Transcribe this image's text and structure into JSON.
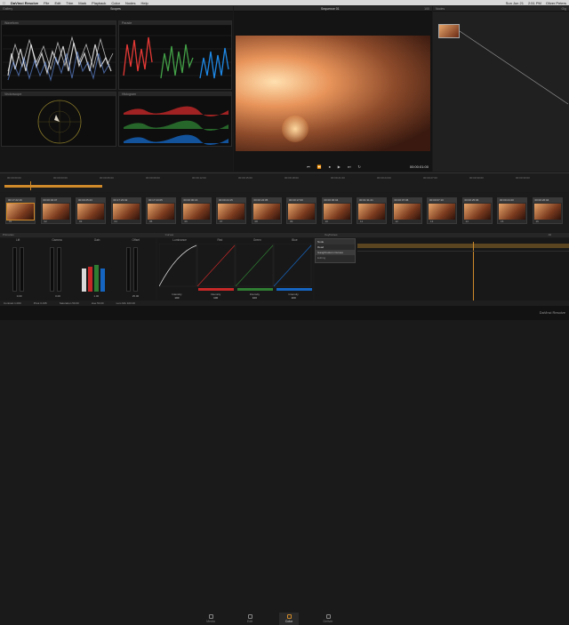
{
  "menubar": {
    "app": "DaVinci Resolve",
    "items": [
      "File",
      "Edit",
      "Trim",
      "Mark",
      "Playback",
      "Color",
      "Nodes",
      "Help"
    ],
    "right": [
      "Sun Jun 21",
      "2:51 PM",
      "Oliver Peters"
    ]
  },
  "panels": {
    "gallery": "Gallery",
    "scopes": "Scopes",
    "waveform": "Waveform",
    "parade": "Parade",
    "vectorscope": "Vectorscope",
    "histogram": "Histogram",
    "viewer_title": "Sequence 01",
    "nodes": "Nodes",
    "lightbox": "Gig"
  },
  "viewer": {
    "timecode": "00:00:01:00",
    "zoom": "100"
  },
  "timeline": {
    "ticks": [
      "00:00:00:00",
      "00:00:03:00",
      "00:00:06:00",
      "00:00:09:00",
      "00:00:12:00",
      "00:00:15:00",
      "00:00:18:00",
      "00:00:21:00",
      "00:00:24:00",
      "00:00:27:00",
      "00:00:30:00",
      "00:00:33:00"
    ]
  },
  "clips": [
    {
      "tc": "00:17:22:16",
      "no": "01"
    },
    {
      "tc": "00:00:02:07",
      "no": "02"
    },
    {
      "tc": "00:00:25:23",
      "no": "03"
    },
    {
      "tc": "00:17:23:02",
      "no": "04"
    },
    {
      "tc": "00:17:23:05",
      "no": "05"
    },
    {
      "tc": "00:00:00:16",
      "no": "06"
    },
    {
      "tc": "00:00:24:15",
      "no": "07"
    },
    {
      "tc": "00:00:22:05",
      "no": "08"
    },
    {
      "tc": "00:00:17:00",
      "no": "09"
    },
    {
      "tc": "00:00:06:04",
      "no": "10"
    },
    {
      "tc": "00:01:31:21",
      "no": "11"
    },
    {
      "tc": "00:00:07:06",
      "no": "12"
    },
    {
      "tc": "00:00:07:10",
      "no": "13"
    },
    {
      "tc": "00:00:25:06",
      "no": "14"
    },
    {
      "tc": "00:00:24:20",
      "no": "15"
    },
    {
      "tc": "00:00:26:04",
      "no": "16"
    }
  ],
  "primaries": {
    "title": "Primaries",
    "wheels": [
      "Lift",
      "Gamma",
      "Gain",
      "Offset"
    ],
    "values": [
      "0.00",
      "0.00",
      "1.00",
      "25.00"
    ]
  },
  "curves": {
    "title": "Curves",
    "labels": [
      "Luminance",
      "Red",
      "Green",
      "Blue"
    ],
    "intensity": "Intensity",
    "intensity_val": "100"
  },
  "keyframes": {
    "title": "Keyframes",
    "all": "All",
    "items": [
      "Sizing",
      "Corrector 1"
    ]
  },
  "popup": {
    "header": "Node",
    "items": [
      "Read",
      "Gang/Custom Curves",
      "Editing"
    ]
  },
  "statusbar": {
    "contrast": "Contrast 1.000",
    "pivot": "Pivot 0.435",
    "saturation": "Saturation 50.00",
    "hue": "Hue 50.00",
    "lum_mix": "Lum Mix 100.00"
  },
  "tabs": [
    "Media",
    "Edit",
    "Color",
    "Deliver"
  ],
  "footer": {
    "brand": "DaVinci Resolve"
  },
  "colors": {
    "accent": "#d08a2a",
    "red": "#c62828",
    "green": "#2e7d32",
    "blue": "#1565c0"
  }
}
